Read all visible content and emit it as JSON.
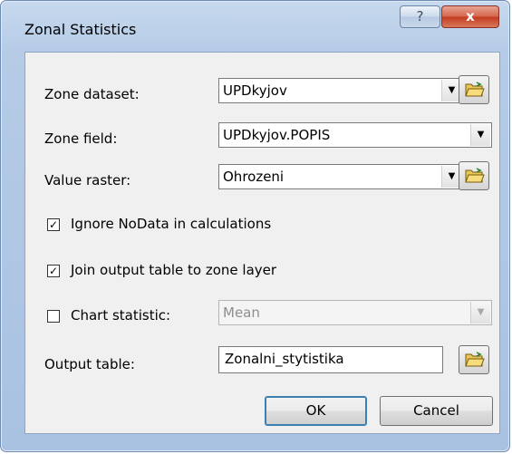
{
  "window": {
    "title": "Zonal Statistics",
    "help_label": "?",
    "close_label": "x"
  },
  "form": {
    "zone_dataset": {
      "label": "Zone dataset:",
      "value": "UPDkyjov"
    },
    "zone_field": {
      "label": "Zone field:",
      "value": "UPDkyjov.POPIS"
    },
    "value_raster": {
      "label": "Value raster:",
      "value": "Ohrozeni"
    },
    "ignore_nodata": {
      "label": "Ignore NoData in calculations",
      "checked": true,
      "mark": "✓"
    },
    "join_output": {
      "label": "Join output table to zone layer",
      "checked": true,
      "mark": "✓"
    },
    "chart_statistic": {
      "label": "Chart statistic:",
      "checked": false,
      "value": "Mean"
    },
    "output_table": {
      "label": "Output table:",
      "value": "Zonalni_stytistika"
    }
  },
  "buttons": {
    "ok": "OK",
    "cancel": "Cancel"
  },
  "colors": {
    "title_bar": "#b5cbe6",
    "close_button": "#c43b20",
    "client_bg": "#f0f0f0"
  }
}
